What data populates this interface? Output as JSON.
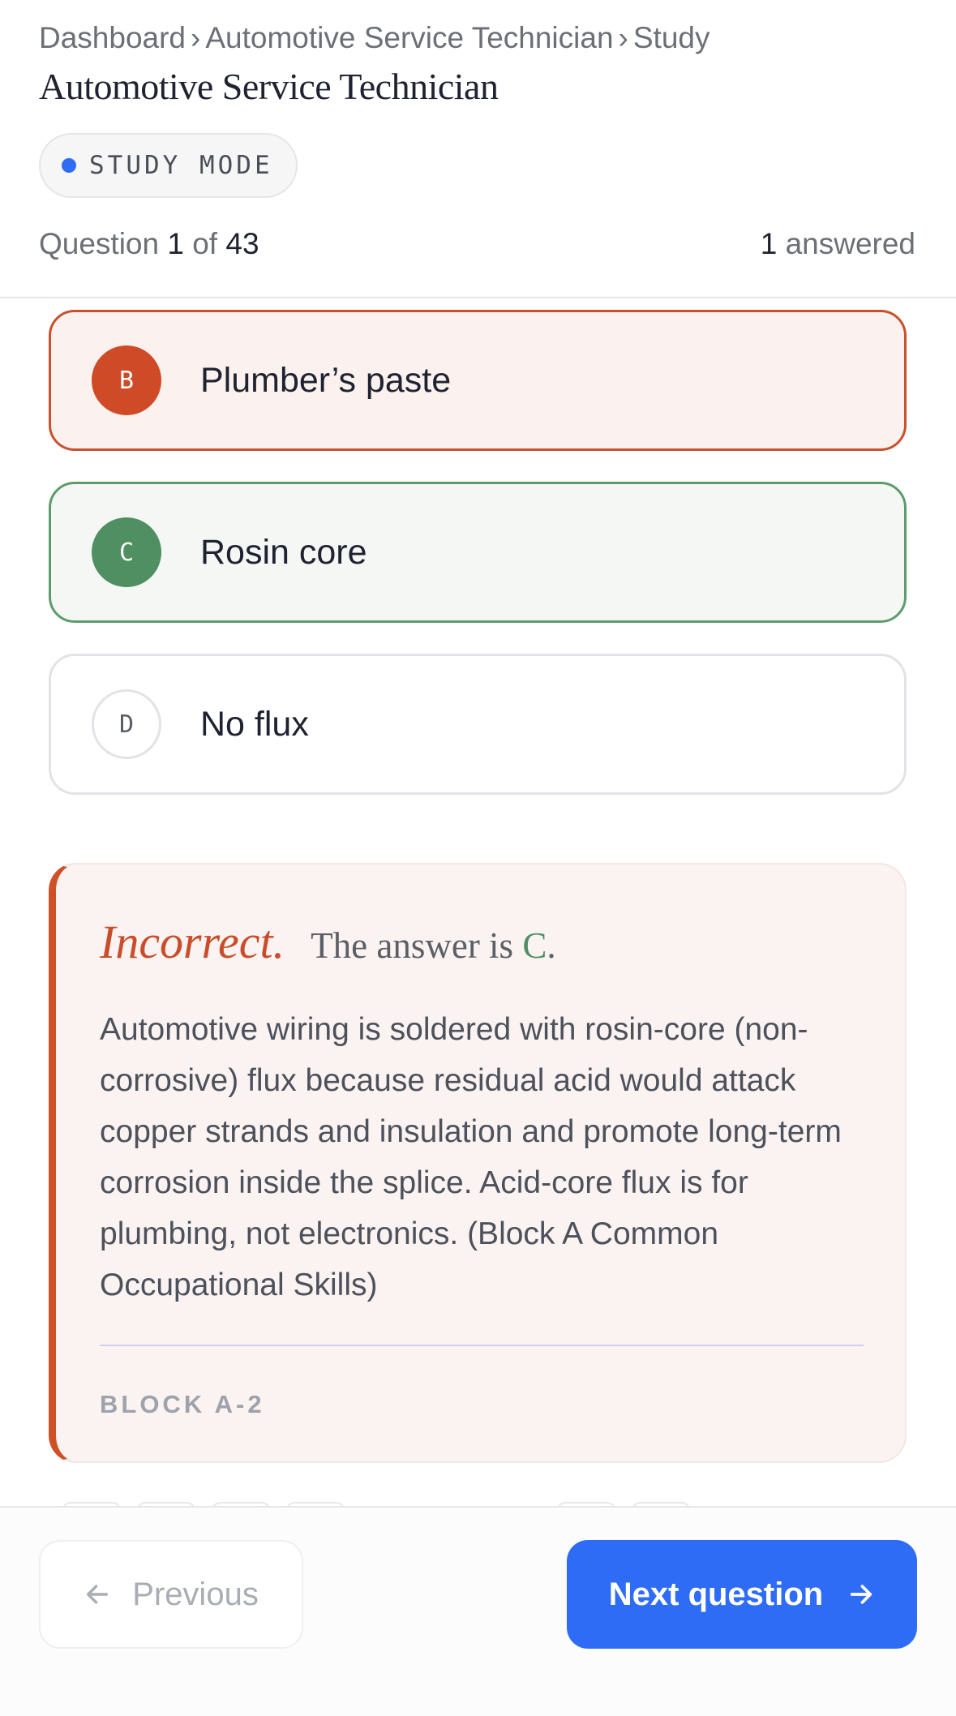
{
  "breadcrumb": {
    "items": [
      "Dashboard",
      "Automotive Service Technician",
      "Study"
    ],
    "separator": "›"
  },
  "page_title": "Automotive Service Technician",
  "mode_badge": "STUDY MODE",
  "progress": {
    "question_label": "Question",
    "current": "1",
    "of_label": "of",
    "total": "43",
    "answered_count": "1",
    "answered_label": "answered"
  },
  "options": [
    {
      "letter": "B",
      "text": "Plumber’s paste",
      "state": "incorrect-selected"
    },
    {
      "letter": "C",
      "text": "Rosin core",
      "state": "correct"
    },
    {
      "letter": "D",
      "text": "No flux",
      "state": "neutral"
    }
  ],
  "feedback": {
    "verdict": "Incorrect.",
    "answer_prefix": "The answer is",
    "answer_letter": "C",
    "answer_suffix": ".",
    "explanation": "Automotive wiring is soldered with rosin-core (non-corrosive) flux because residual acid would attack copper strands and insulation and promote long-term corrosion inside the splice. Acid-core flux is for plumbing, not electronics. (Block A Common Occupational Skills)",
    "block_code": "BLOCK A-2"
  },
  "footer": {
    "previous_label": "Previous",
    "next_label": "Next question"
  },
  "colors": {
    "accent": "#2f6cf5",
    "incorrect": "#cf4a27",
    "correct": "#4f8f61"
  }
}
